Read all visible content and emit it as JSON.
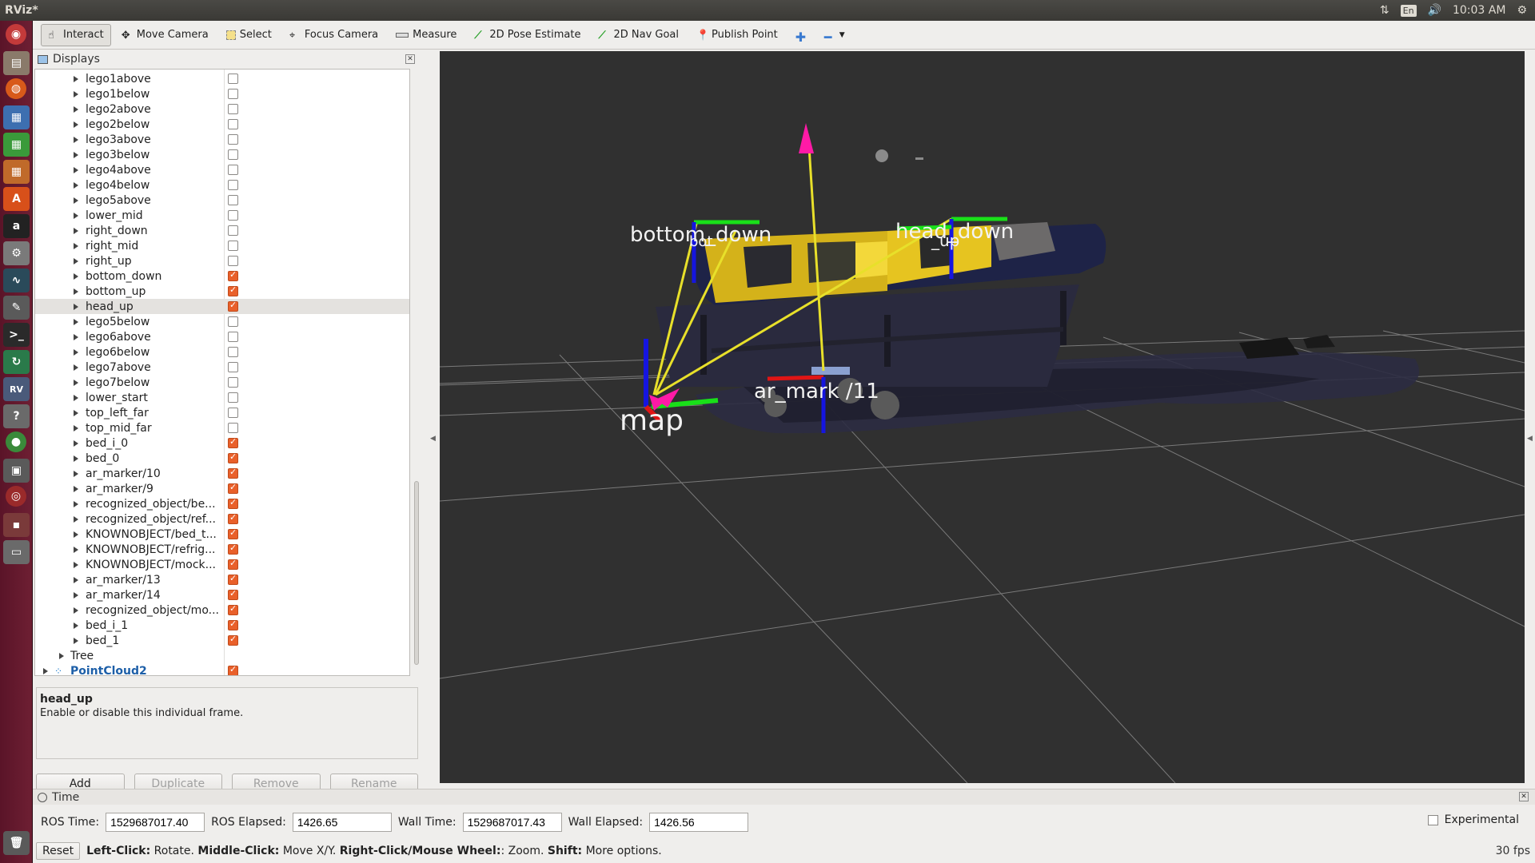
{
  "topbar": {
    "title": "RViz*",
    "lang": "En",
    "time": "10:03 AM"
  },
  "toolbar": {
    "tools": [
      {
        "label": "Interact",
        "name": "tool-interact"
      },
      {
        "label": "Move Camera",
        "name": "tool-move-camera"
      },
      {
        "label": "Select",
        "name": "tool-select"
      },
      {
        "label": "Focus Camera",
        "name": "tool-focus-camera"
      },
      {
        "label": "Measure",
        "name": "tool-measure"
      },
      {
        "label": "2D Pose Estimate",
        "name": "tool-2d-pose-estimate"
      },
      {
        "label": "2D Nav Goal",
        "name": "tool-2d-nav-goal"
      },
      {
        "label": "Publish Point",
        "name": "tool-publish-point"
      }
    ]
  },
  "displays": {
    "title": "Displays",
    "items": [
      {
        "label": "lego1above",
        "checked": false
      },
      {
        "label": "lego1below",
        "checked": false
      },
      {
        "label": "lego2above",
        "checked": false
      },
      {
        "label": "lego2below",
        "checked": false
      },
      {
        "label": "lego3above",
        "checked": false
      },
      {
        "label": "lego3below",
        "checked": false
      },
      {
        "label": "lego4above",
        "checked": false
      },
      {
        "label": "lego4below",
        "checked": false
      },
      {
        "label": "lego5above",
        "checked": false
      },
      {
        "label": "lower_mid",
        "checked": false
      },
      {
        "label": "right_down",
        "checked": false
      },
      {
        "label": "right_mid",
        "checked": false
      },
      {
        "label": "right_up",
        "checked": false
      },
      {
        "label": "bottom_down",
        "checked": true
      },
      {
        "label": "bottom_up",
        "checked": true
      },
      {
        "label": "head_up",
        "checked": true,
        "selected": true
      },
      {
        "label": "lego5below",
        "checked": false
      },
      {
        "label": "lego6above",
        "checked": false
      },
      {
        "label": "lego6below",
        "checked": false
      },
      {
        "label": "lego7above",
        "checked": false
      },
      {
        "label": "lego7below",
        "checked": false
      },
      {
        "label": "lower_start",
        "checked": false
      },
      {
        "label": "top_left_far",
        "checked": false
      },
      {
        "label": "top_mid_far",
        "checked": false
      },
      {
        "label": "bed_i_0",
        "checked": true
      },
      {
        "label": "bed_0",
        "checked": true
      },
      {
        "label": "ar_marker/10",
        "checked": true
      },
      {
        "label": "ar_marker/9",
        "checked": true
      },
      {
        "label": "recognized_object/be...",
        "checked": true
      },
      {
        "label": "recognized_object/ref...",
        "checked": true
      },
      {
        "label": "KNOWNOBJECT/bed_t...",
        "checked": true
      },
      {
        "label": "KNOWNOBJECT/refrig...",
        "checked": true
      },
      {
        "label": "KNOWNOBJECT/mock...",
        "checked": true
      },
      {
        "label": "ar_marker/13",
        "checked": true
      },
      {
        "label": "ar_marker/14",
        "checked": true
      },
      {
        "label": "recognized_object/mo...",
        "checked": true
      },
      {
        "label": "bed_i_1",
        "checked": true
      },
      {
        "label": "bed_1",
        "checked": true
      }
    ],
    "tree_label": "Tree",
    "pointcloud_label": "PointCloud2",
    "pointcloud_checked": true
  },
  "description": {
    "title": "head_up",
    "text": "Enable or disable this individual frame."
  },
  "buttons": {
    "add": "Add",
    "duplicate": "Duplicate",
    "remove": "Remove",
    "rename": "Rename"
  },
  "view": {
    "labels": {
      "bottom_down": "bottom_down",
      "head_down": "head_down",
      "head_up_small": "_up",
      "ar_marker": "ar_mark /11",
      "map": "map",
      "bottom_small": "bot"
    }
  },
  "time": {
    "panel_title": "Time",
    "ros_time_label": "ROS Time:",
    "ros_time": "1529687017.40",
    "ros_elapsed_label": "ROS Elapsed:",
    "ros_elapsed": "1426.65",
    "wall_time_label": "Wall Time:",
    "wall_time": "1529687017.43",
    "wall_elapsed_label": "Wall Elapsed:",
    "wall_elapsed": "1426.56",
    "experimental_label": "Experimental"
  },
  "status": {
    "reset": "Reset",
    "left_click": "Left-Click:",
    "left_action": "Rotate.",
    "middle_click": "Middle-Click:",
    "middle_action": "Move X/Y.",
    "right_click": "Right-Click/Mouse Wheel:",
    "right_action": ": Zoom.",
    "shift": "Shift:",
    "shift_action": "More options.",
    "fps": "30 fps"
  }
}
